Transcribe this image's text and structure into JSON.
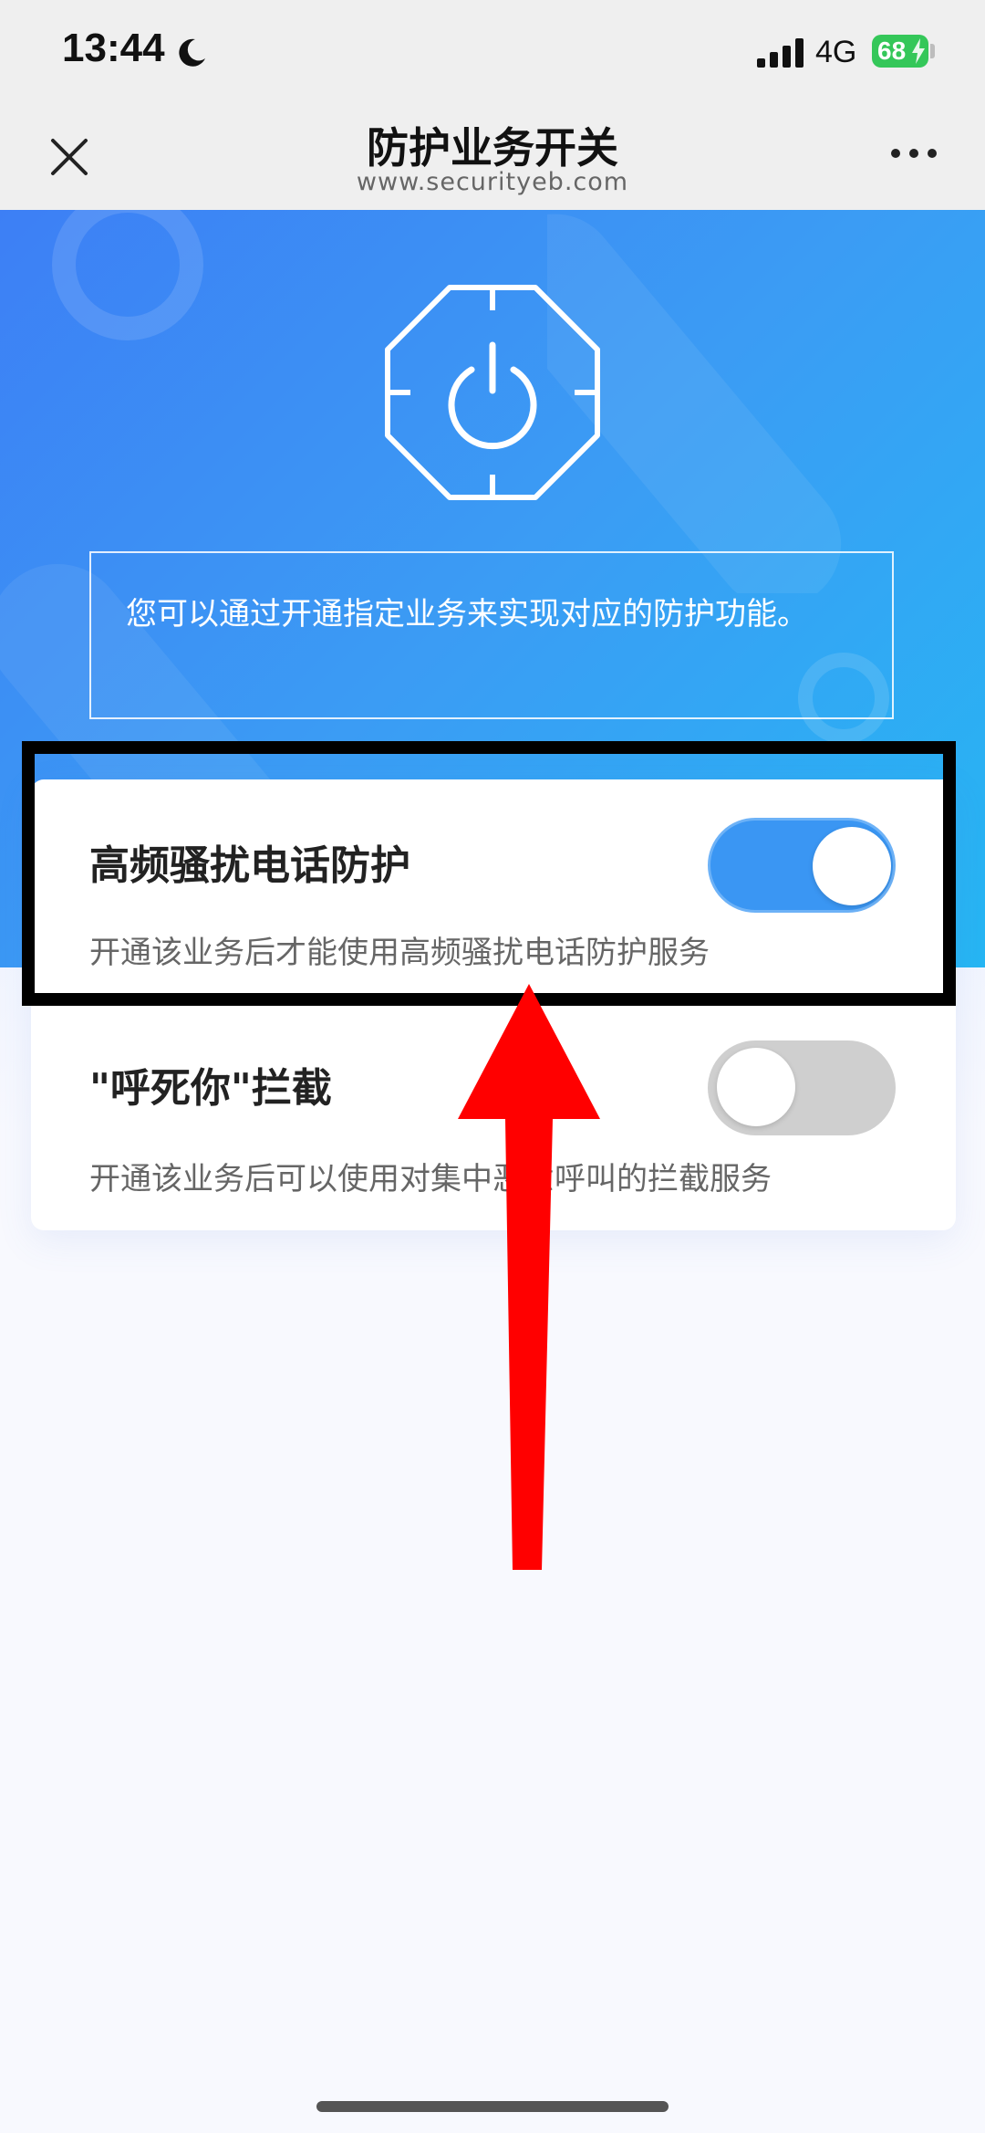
{
  "status_bar": {
    "time": "13:44",
    "network": "4G",
    "battery": "68"
  },
  "nav": {
    "title": "防护业务开关",
    "subtitle": "www.securityeb.com"
  },
  "hero": {
    "description": "您可以通过开通指定业务来实现对应的防护功能。"
  },
  "services": [
    {
      "title": "高频骚扰电话防护",
      "description": "开通该业务后才能使用高频骚扰电话防护服务",
      "enabled": true
    },
    {
      "title": "\"呼死你\"拦截",
      "description": "开通该业务后可以使用对集中恶意呼叫的拦截服务",
      "enabled": false
    }
  ],
  "colors": {
    "accent": "#3a96f3",
    "hero_start": "#3d7ff5",
    "hero_end": "#26b6f3",
    "annotation_arrow": "#ff0000",
    "annotation_box": "#000000"
  }
}
